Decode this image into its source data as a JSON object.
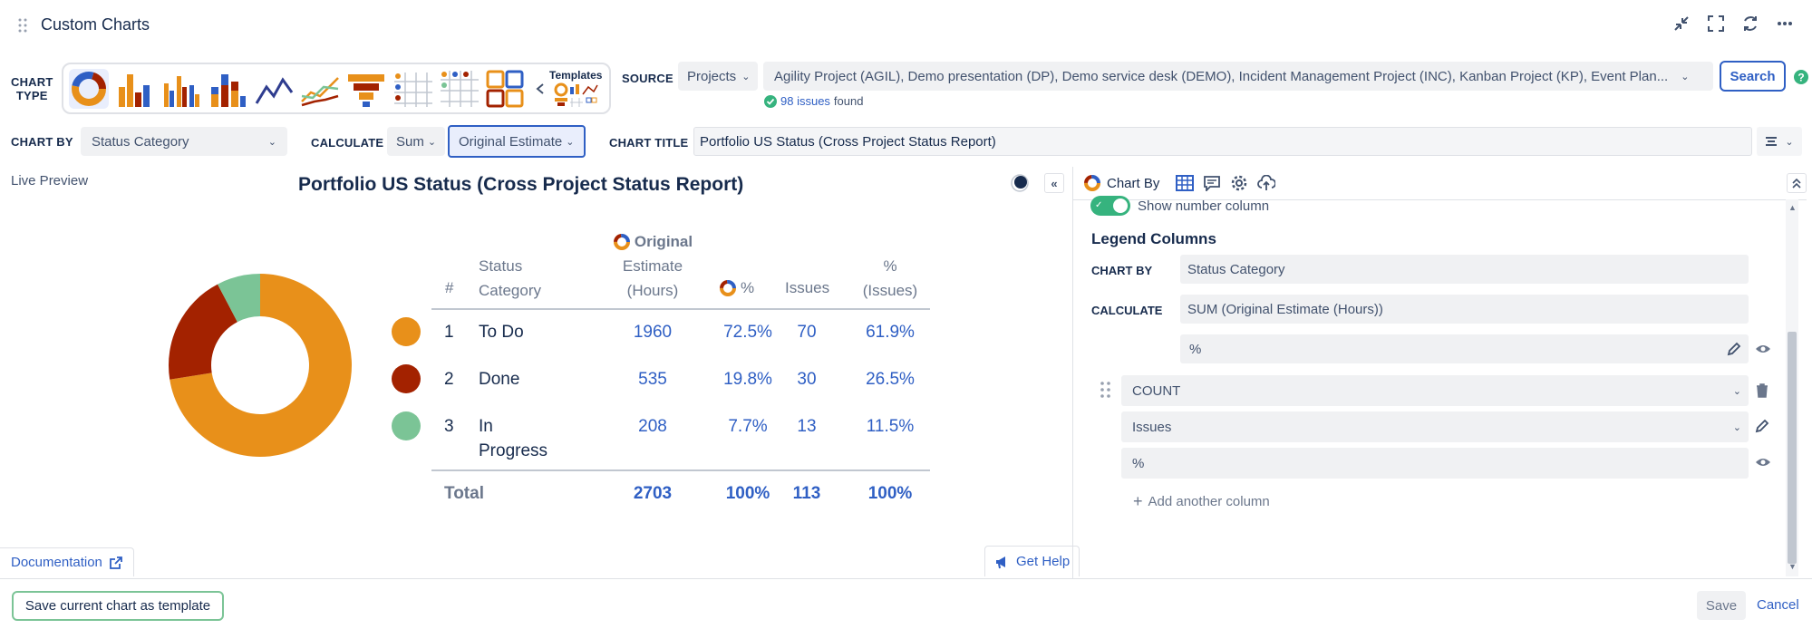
{
  "header": {
    "title": "Custom Charts"
  },
  "toolbar": {
    "chart_type_label_1": "CHART",
    "chart_type_label_2": "TYPE",
    "templates_label": "Templates",
    "source_label": "SOURCE",
    "source_select": "Projects",
    "source_projects": "Agility Project (AGIL), Demo presentation (DP), Demo service desk (DEMO), Incident Management Project (INC), Kanban Project (KP), Event Plan...",
    "issues_count": "98 issues",
    "issues_found": "found",
    "search_label": "Search",
    "chart_by_label": "CHART BY",
    "chart_by_value": "Status Category",
    "calculate_label": "CALCULATE",
    "calculate_value": "Sum",
    "calculate_field": "Original Estimate",
    "chart_title_label": "CHART TITLE",
    "chart_title_value": "Portfolio US Status (Cross Project Status Report)"
  },
  "preview": {
    "live_preview": "Live Preview",
    "title": "Portfolio US Status (Cross Project Status Report)",
    "documentation": "Documentation",
    "get_help": "Get Help"
  },
  "table": {
    "headers": {
      "num": "#",
      "status_1": "Status",
      "status_2": "Category",
      "est_1": "Original",
      "est_2": "Estimate",
      "est_3": "(Hours)",
      "pct": "%",
      "issues": "Issues",
      "pct_issues_1": "%",
      "pct_issues_2": "(Issues)"
    },
    "rows": [
      {
        "num": "1",
        "category": "To Do",
        "category_2": "",
        "estimate": "1960",
        "pct": "72.5%",
        "issues": "70",
        "pct_issues": "61.9%",
        "color": "#e8901a"
      },
      {
        "num": "2",
        "category": "Done",
        "category_2": "",
        "estimate": "535",
        "pct": "19.8%",
        "issues": "30",
        "pct_issues": "26.5%",
        "color": "#a32200"
      },
      {
        "num": "3",
        "category": "In",
        "category_2": "Progress",
        "estimate": "208",
        "pct": "7.7%",
        "issues": "13",
        "pct_issues": "11.5%",
        "color": "#7bc496"
      }
    ],
    "total": {
      "label": "Total",
      "estimate": "2703",
      "pct": "100%",
      "issues": "113",
      "pct_issues": "100%"
    }
  },
  "chart_data": {
    "type": "pie",
    "categories": [
      "To Do",
      "Done",
      "In Progress"
    ],
    "values": [
      1960,
      535,
      208
    ],
    "colors": [
      "#e8901a",
      "#a32200",
      "#7bc496"
    ],
    "title": "Portfolio US Status (Cross Project Status Report)"
  },
  "panel": {
    "chart_by_tab": "Chart By",
    "show_number_column": "Show number column",
    "legend_columns": "Legend Columns",
    "chart_by_label": "CHART BY",
    "chart_by_value": "Status Category",
    "calculate_label": "CALCULATE",
    "calculate_value": "SUM (Original Estimate (Hours))",
    "pct_value": "%",
    "count_value": "COUNT",
    "issues_value": "Issues",
    "pct2_value": "%",
    "add_column": "Add another column"
  },
  "footer": {
    "save_template": "Save current chart as template",
    "save": "Save",
    "cancel": "Cancel"
  }
}
